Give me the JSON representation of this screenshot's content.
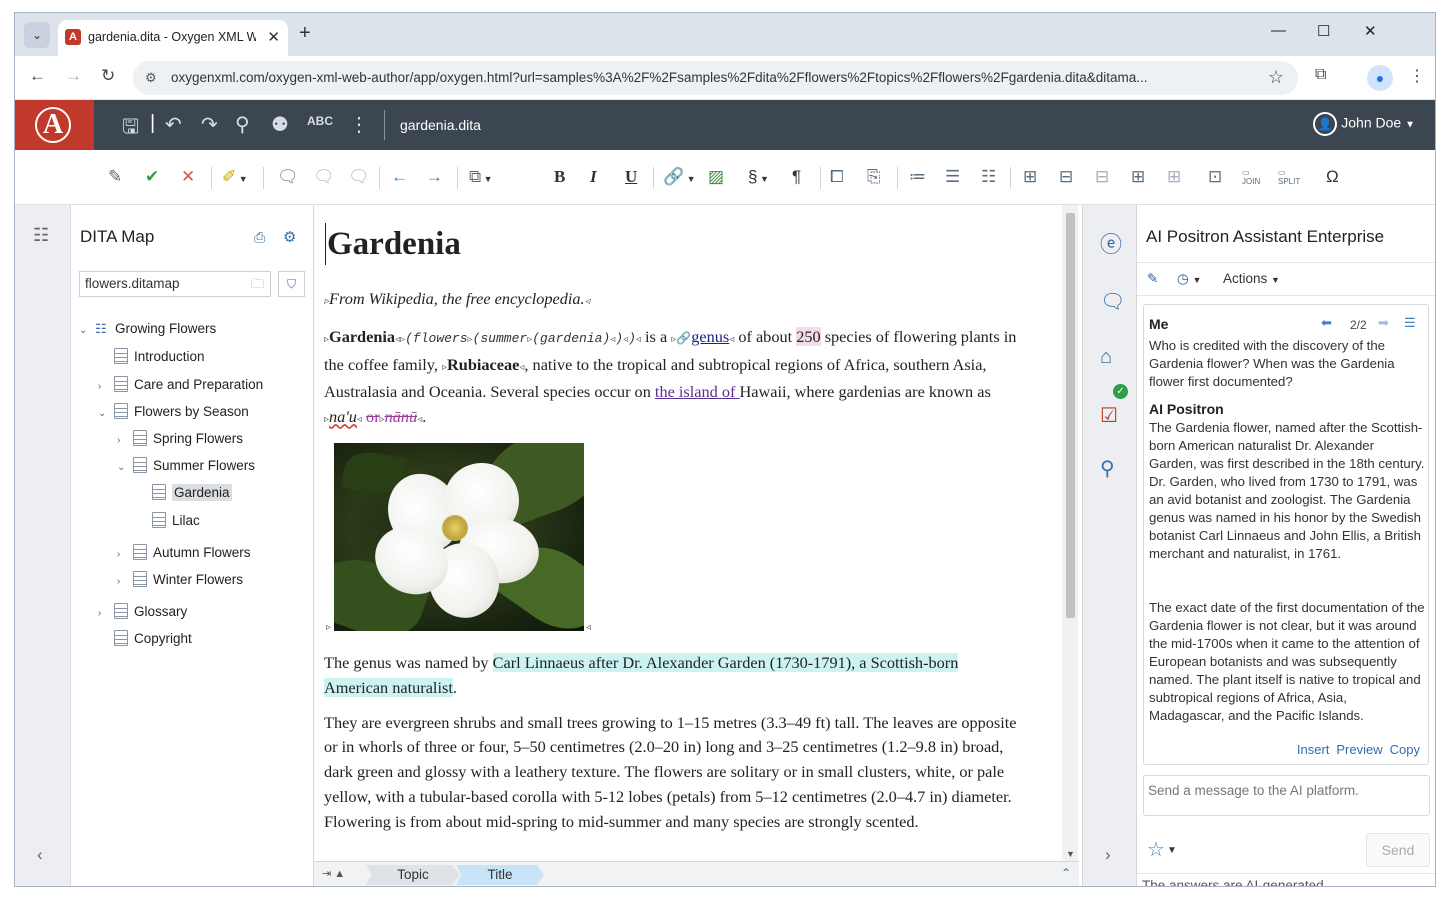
{
  "browser": {
    "tab_title": "gardenia.dita - Oxygen XML We",
    "url": "oxygenxml.com/oxygen-xml-web-author/app/oxygen.html?url=samples%3A%2F%2Fsamples%2Fdita%2Fflowers%2Ftopics%2Fflowers%2Fgardenia.dita&ditama..."
  },
  "app": {
    "doc_name": "gardenia.dita",
    "user_name": "John Doe"
  },
  "dita_map": {
    "title": "DITA Map",
    "map_file": "flowers.ditamap",
    "tree": [
      {
        "label": "Growing Flowers"
      },
      {
        "label": "Introduction"
      },
      {
        "label": "Care and Preparation"
      },
      {
        "label": "Flowers by Season"
      },
      {
        "label": "Spring Flowers"
      },
      {
        "label": "Summer Flowers"
      },
      {
        "label": "Gardenia"
      },
      {
        "label": "Lilac"
      },
      {
        "label": "Autumn Flowers"
      },
      {
        "label": "Winter Flowers"
      },
      {
        "label": "Glossary"
      },
      {
        "label": "Copyright"
      }
    ]
  },
  "doc": {
    "title": "Gardenia",
    "shortdesc": "From Wikipedia, the free encyclopedia.",
    "p1": {
      "term": "Gardenia",
      "kw1": "(flowers",
      "kw2": "(summer",
      "kw3": "(gardenia)",
      "close": ")",
      "t1": " is a ",
      "link_genus": "genus",
      "t2": " of about ",
      "num": "250",
      "t3": " species of flowering plants in the coffee family, ",
      "family": "Rubiaceae",
      "t4": ", native to the tropical and subtropical regions of Africa, southern Asia, Australasia and Oceania. Several species occur on ",
      "link_island": "the island of ",
      "t5": "Hawaii, where gardenias are known as ",
      "naau": "na'u",
      "deleted": "or",
      "nanu": "nānū",
      "end": "."
    },
    "p2_pre": "The genus was named by ",
    "p2_hl": "Carl Linnaeus after Dr. Alexander Garden (1730-1791), a Scottish-born American naturalist",
    "p2_post": ".",
    "p3": "They are evergreen shrubs and small trees growing to 1–15 metres (3.3–49 ft) tall. The leaves are opposite or in whorls of three or four, 5–50 centimetres (2.0–20 in) long and 3–25 centimetres (1.2–9.8 in) broad, dark green and glossy with a leathery texture. The flowers are solitary or in small clusters, white, or pale yellow, with a tubular-based corolla with 5-12 lobes (petals) from 5–12 centimetres (2.0–4.7 in) diameter. Flowering is from about mid-spring to mid-summer and many species are strongly scented."
  },
  "breadcrumb": {
    "item1": "Topic",
    "item2": "Title"
  },
  "ai": {
    "title": "AI Positron Assistant Enterprise",
    "actions_label": "Actions",
    "page": "2/2",
    "me_label": "Me",
    "question": "Who is credited with the discovery of the Gardenia flower? When was the Gardenia flower first documented?",
    "bot_label": "AI Positron",
    "answer1": "The Gardenia flower, named after the Scottish-born American naturalist Dr. Alexander Garden, was first described in the 18th century. Dr. Garden, who lived from 1730 to 1791, was an avid botanist and zoologist. The Gardenia genus was named in his honor by the Swedish botanist Carl Linnaeus and John Ellis, a British merchant and naturalist, in 1761.",
    "answer2": "The exact date of the first documentation of the Gardenia flower is not clear, but it was around the mid-1700s when it came to the attention of European botanists and was subsequently named. The plant itself is native to tropical and subtropical regions of Africa, Asia, Madagascar, and the Pacific Islands.",
    "insert": "Insert",
    "preview": "Preview",
    "copy": "Copy",
    "placeholder": "Send a message to the AI platform.",
    "send": "Send",
    "footer": "The answers are AI-generated."
  },
  "colors": {
    "header_bg": "#3c4650",
    "logo_bg": "#c0392b",
    "accent": "#3a6ea5"
  }
}
